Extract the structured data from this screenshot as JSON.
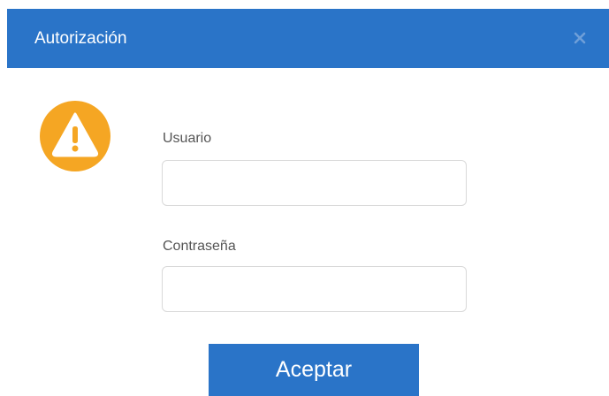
{
  "dialog": {
    "title": "Autorización",
    "icons": {
      "close": "close-icon",
      "warning": "warning-icon"
    },
    "colors": {
      "accent": "#2a74c8",
      "warning": "#f5a623"
    }
  },
  "form": {
    "user_label": "Usuario",
    "user_value": "",
    "password_label": "Contraseña",
    "password_value": ""
  },
  "actions": {
    "accept_label": "Aceptar"
  }
}
